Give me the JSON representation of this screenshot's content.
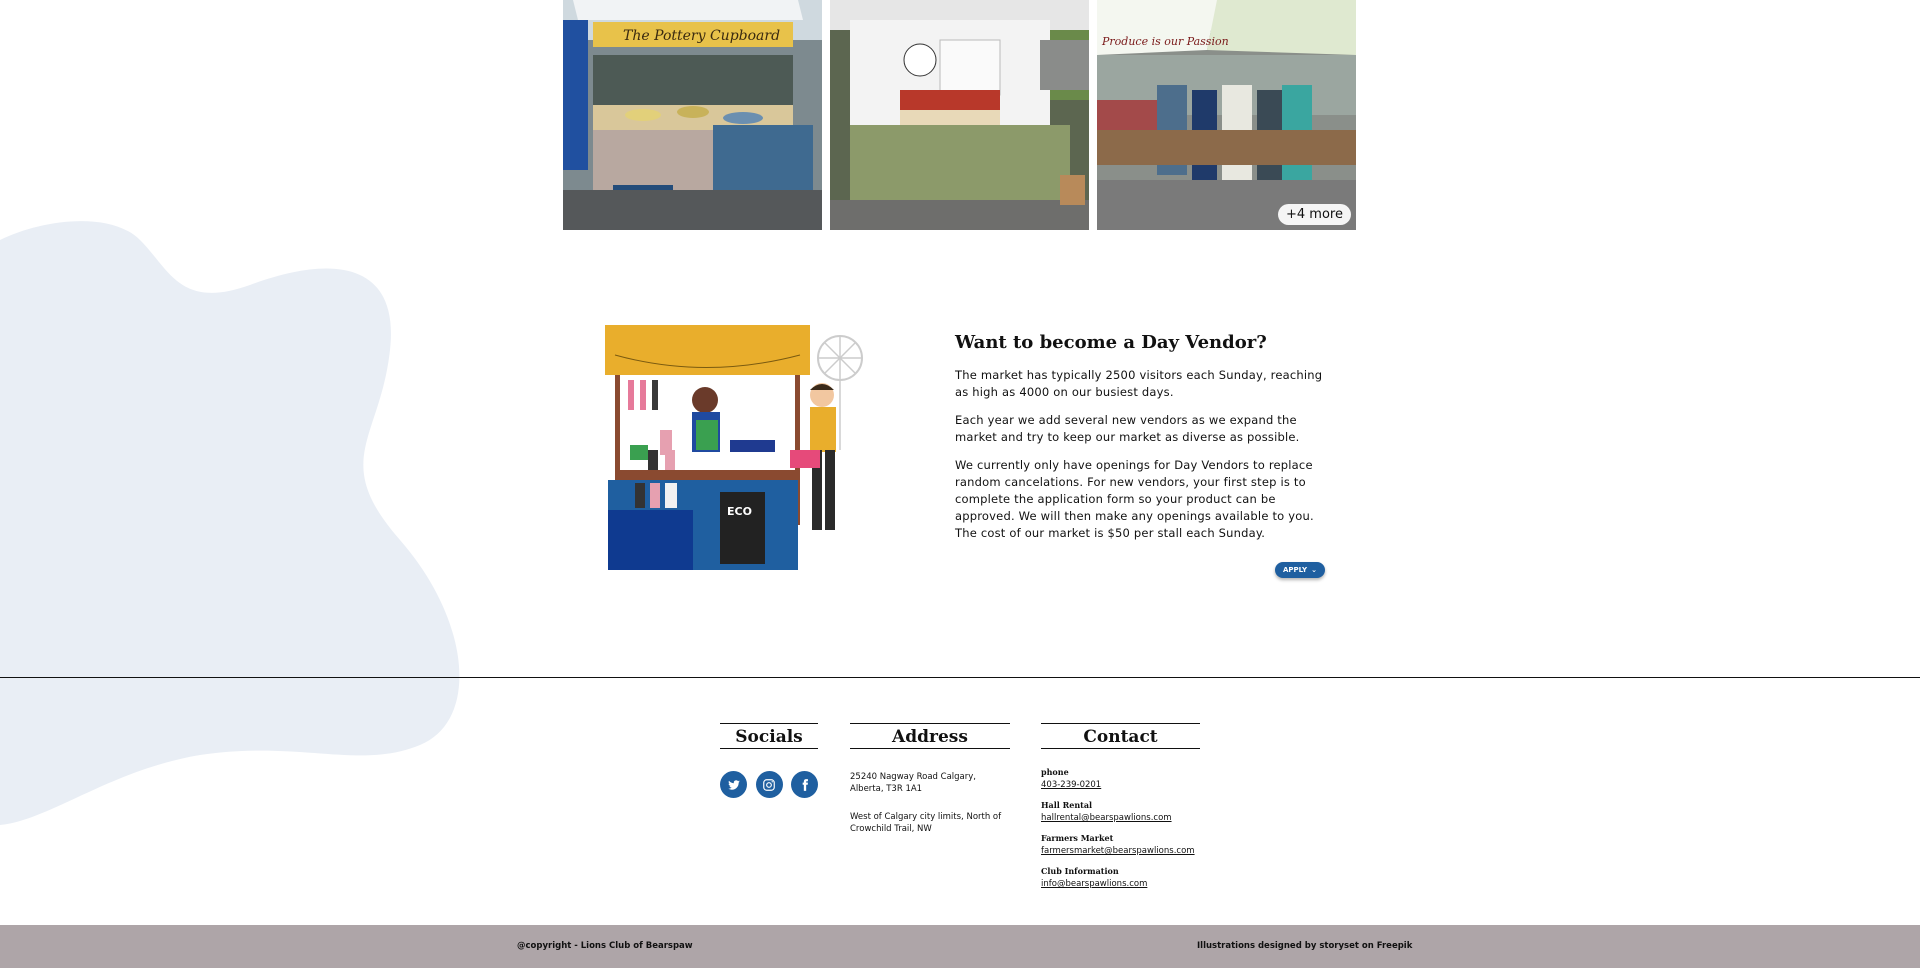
{
  "gallery": {
    "more_label": "+4 more",
    "photos": [
      {
        "sign_text": "The Pottery Cupboard"
      },
      {
        "sign_text": ""
      },
      {
        "sign_text": "Produce is our Passion"
      }
    ]
  },
  "vendor_section": {
    "title": "Want to become a Day Vendor?",
    "paragraphs": [
      "The market has typically 2500 visitors each Sunday, reaching as high as 4000 on our busiest days.",
      "Each year we add several new vendors as we expand the market and try to keep our market as diverse as possible.",
      "We currently only have openings for Day Vendors to replace random cancelations. For new vendors, your first step is to complete the application form so your product can be approved. We will then make any openings available to you. The cost of our market is $50 per stall each Sunday."
    ],
    "apply_label": "APPLY",
    "illustration_sign": "ECO"
  },
  "footer": {
    "socials": {
      "title": "Socials",
      "icons": [
        "twitter-icon",
        "instagram-icon",
        "facebook-icon"
      ]
    },
    "address": {
      "title": "Address",
      "line1": "25240 Nagway Road Calgary, Alberta, T3R 1A1",
      "line2": "West of Calgary city limits, North of Crowchild Trail, NW"
    },
    "contact": {
      "title": "Contact",
      "items": [
        {
          "label": "phone",
          "value": "403-239-0201"
        },
        {
          "label": "Hall Rental",
          "value": "hallrental@bearspawlions.com"
        },
        {
          "label": "Farmers Market",
          "value": "farmersmarket@bearspawlions.com"
        },
        {
          "label": "Club Information",
          "value": "info@bearspawlions.com"
        }
      ]
    }
  },
  "bottom_bar": {
    "copyright": "@copyright - Lions Club of Bearspaw",
    "credit": "Illustrations designed by storyset on Freepik"
  },
  "colors": {
    "accent": "#1f5fa0",
    "blob": "#e9eef5",
    "bottom_bar": "#aea5a8"
  }
}
